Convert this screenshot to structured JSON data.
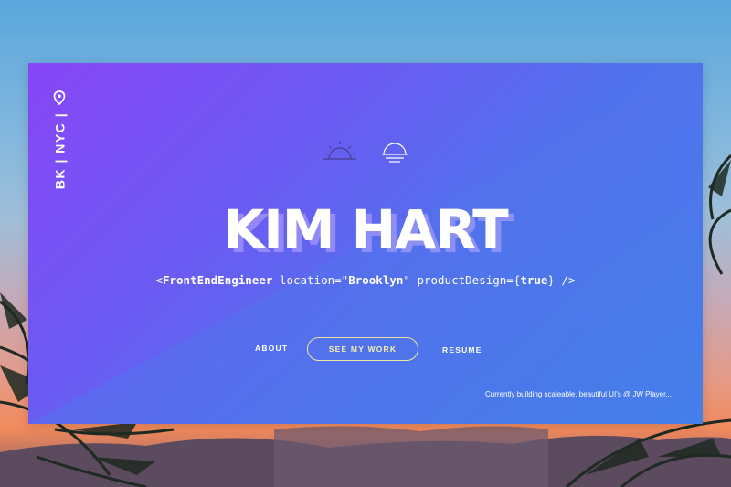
{
  "location": {
    "text": "BK | NYC |",
    "icon": "map-pin-icon"
  },
  "icons": [
    "sunrise-icon",
    "sunset-icon"
  ],
  "name": "KIM HART",
  "tagline": {
    "open": "<",
    "component": "FrontEndEngineer",
    "attr1": " location=\"",
    "value1": "Brooklyn",
    "attr2": "\" productDesign={",
    "value2": "true",
    "close": "} />"
  },
  "nav": {
    "about": "ABOUT",
    "work": "SEE MY WORK",
    "resume": "RESUME"
  },
  "status": "Currently building scaleable, beautiful UI's @ JW Player...",
  "colors": {
    "gradient_start": "#8846f7",
    "gradient_end": "#3d88ea",
    "button_outline": "#f0e6a0"
  }
}
